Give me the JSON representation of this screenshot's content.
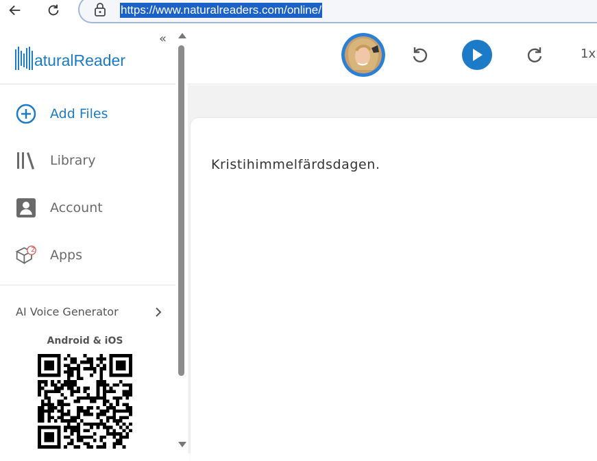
{
  "browser": {
    "url": "https://www.naturalreaders.com/online/"
  },
  "sidebar": {
    "logo_text": "aturalReader",
    "collapse_symbol": "«",
    "items": [
      {
        "label": "Add Files",
        "icon": "add-circle-icon",
        "active": true
      },
      {
        "label": "Library",
        "icon": "library-icon",
        "active": false
      },
      {
        "label": "Account",
        "icon": "account-icon",
        "active": false
      },
      {
        "label": "Apps",
        "icon": "apps-box-icon",
        "badge": "2",
        "active": false
      }
    ],
    "ai_voice_label": "AI Voice Generator",
    "android_ios_label": "Android & iOS"
  },
  "player": {
    "speed_label": "1x"
  },
  "document": {
    "text": "Kristihimmelfärdsdagen."
  },
  "colors": {
    "brand": "#1b7bc9",
    "url_highlight": "#1a62c8",
    "badge": "#e05656"
  }
}
